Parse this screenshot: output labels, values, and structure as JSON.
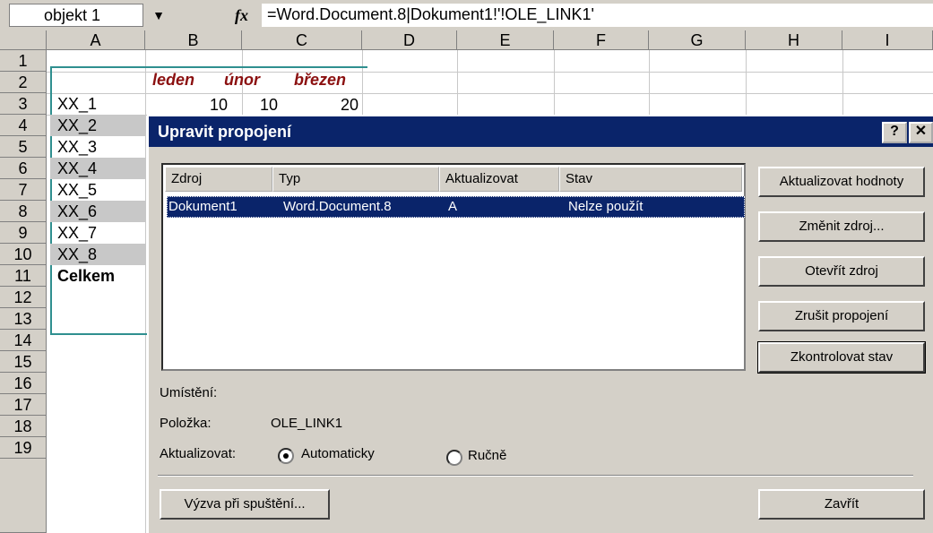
{
  "namebox": {
    "value": "objekt 1"
  },
  "formula_bar": {
    "fx_label": "fx",
    "value": "=Word.Document.8|Dokument1!'!OLE_LINK1'"
  },
  "columns": [
    "A",
    "B",
    "C",
    "D",
    "E",
    "F",
    "G",
    "H",
    "I"
  ],
  "rows": [
    "1",
    "2",
    "3",
    "4",
    "5",
    "6",
    "7",
    "8",
    "9",
    "10",
    "11",
    "12",
    "13",
    "14",
    "15",
    "16",
    "17",
    "18",
    "19"
  ],
  "sheet": {
    "months": [
      "leden",
      "únor",
      "březen"
    ],
    "row2_values": [
      "10",
      "10",
      "20"
    ],
    "labels": [
      "XX_1",
      "XX_2",
      "XX_3",
      "XX_4",
      "XX_5",
      "XX_6",
      "XX_7",
      "XX_8",
      "Celkem"
    ]
  },
  "dialog": {
    "title": "Upravit propojení",
    "help_btn": "?",
    "close_btn": "✕",
    "list_headers": [
      "Zdroj",
      "Typ",
      "Aktualizovat",
      "Stav"
    ],
    "rows": [
      {
        "zdroj": "Dokument1",
        "typ": "Word.Document.8",
        "aktualizovat": "A",
        "stav": "Nelze použít"
      }
    ],
    "buttons": {
      "update_values": "Aktualizovat hodnoty",
      "change_source": "Změnit zdroj...",
      "open_source": "Otevřít zdroj",
      "break_link": "Zrušit propojení",
      "check_status": "Zkontrolovat stav",
      "startup_prompt": "Výzva při spuštění...",
      "close": "Zavřít"
    },
    "location_label": "Umístění:",
    "location_value": "",
    "item_label": "Položka:",
    "item_value": "OLE_LINK1",
    "update_label": "Aktualizovat:",
    "radio_auto": "Automaticky",
    "radio_manual": "Ručně",
    "selected_update": "Automaticky"
  }
}
